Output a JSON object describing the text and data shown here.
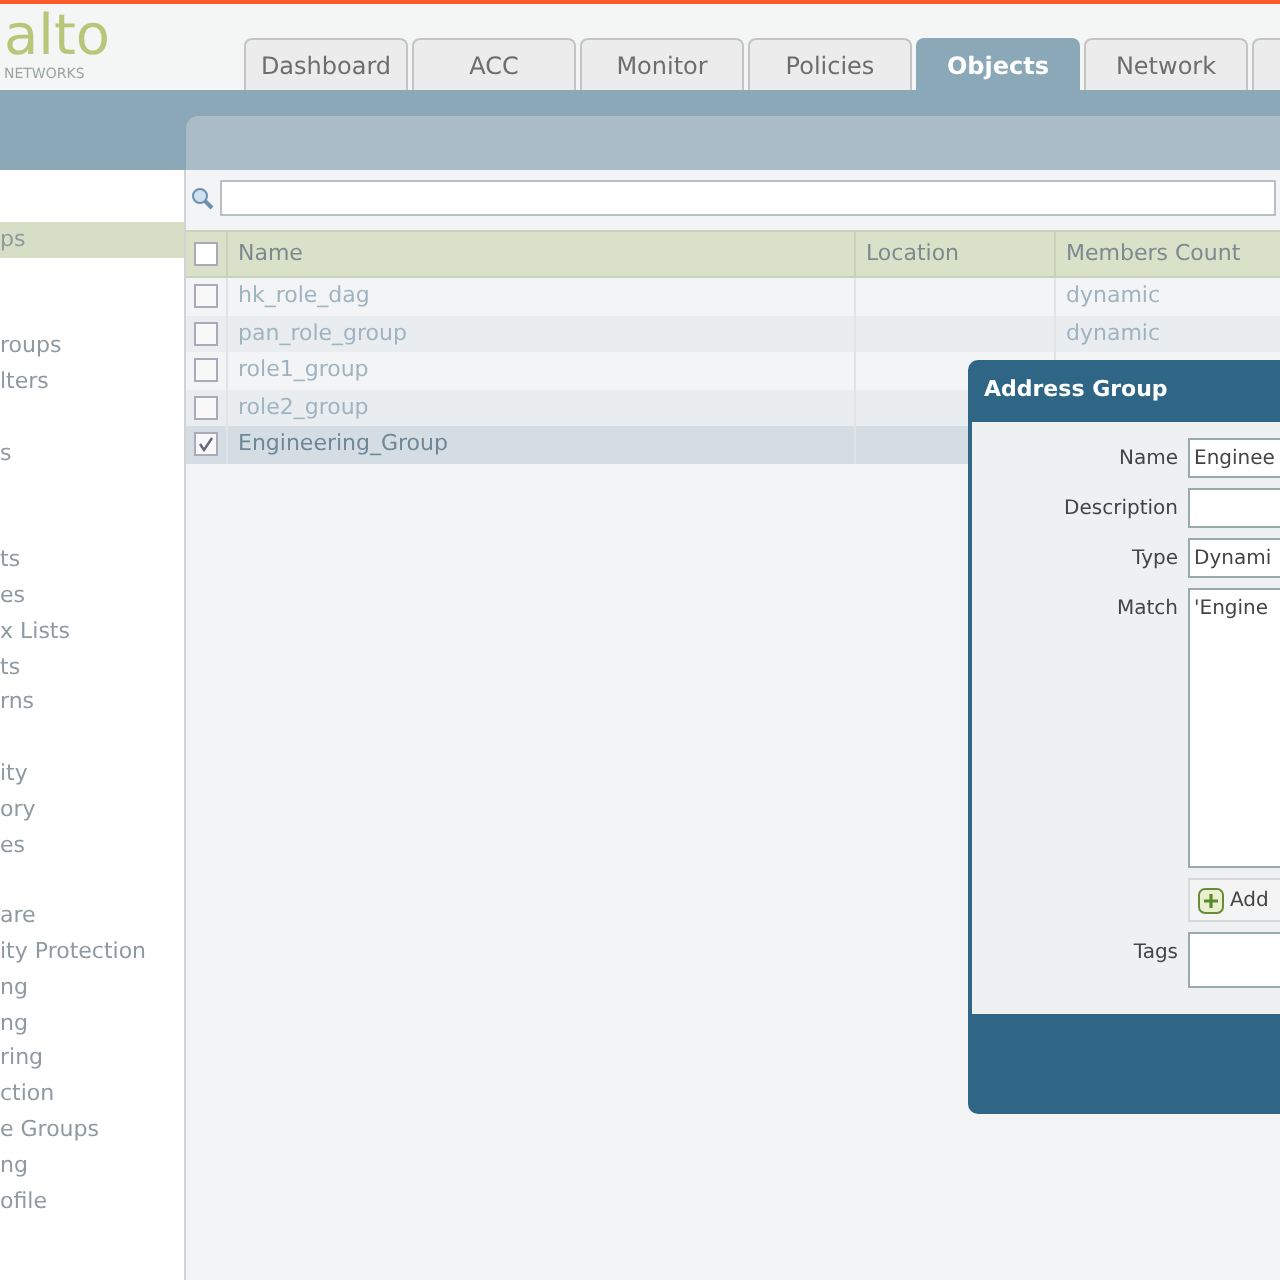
{
  "logo": {
    "wordmark": "alto",
    "tagline": "NETWORKS"
  },
  "tabs": [
    {
      "label": "Dashboard",
      "selected": false
    },
    {
      "label": "ACC",
      "selected": false
    },
    {
      "label": "Monitor",
      "selected": false
    },
    {
      "label": "Policies",
      "selected": false
    },
    {
      "label": "Objects",
      "selected": true
    },
    {
      "label": "Network",
      "selected": false
    }
  ],
  "sidebar": {
    "groups": [
      {
        "items": [
          {
            "label": "ps",
            "selected": true
          }
        ]
      },
      {
        "items": [
          {
            "label": "roups",
            "selected": false
          },
          {
            "label": "lters",
            "selected": false
          }
        ]
      },
      {
        "items": [
          {
            "label": "s",
            "selected": false
          }
        ]
      },
      {
        "items": [
          {
            "label": "ts",
            "selected": false
          },
          {
            "label": "es",
            "selected": false
          },
          {
            "label": "x Lists",
            "selected": false
          },
          {
            "label": "ts",
            "selected": false
          },
          {
            "label": "rns",
            "selected": false
          }
        ]
      },
      {
        "items": [
          {
            "label": "ity",
            "selected": false
          },
          {
            "label": "ory",
            "selected": false
          },
          {
            "label": "es",
            "selected": false
          }
        ]
      },
      {
        "items": [
          {
            "label": "are",
            "selected": false
          },
          {
            "label": "ity Protection",
            "selected": false
          },
          {
            "label": "ng",
            "selected": false
          },
          {
            "label": "ng",
            "selected": false
          },
          {
            "label": "ring",
            "selected": false
          },
          {
            "label": "ction",
            "selected": false
          },
          {
            "label": "e Groups",
            "selected": false
          },
          {
            "label": "ng",
            "selected": false
          },
          {
            "label": "ofile",
            "selected": false
          }
        ]
      }
    ]
  },
  "table": {
    "all_checked": false,
    "columns": [
      "Name",
      "Location",
      "Members Count"
    ],
    "rows": [
      {
        "name": "hk_role_dag",
        "members_count": "dynamic",
        "checked": false,
        "selected": false
      },
      {
        "name": "pan_role_group",
        "members_count": "dynamic",
        "checked": false,
        "selected": false
      },
      {
        "name": "role1_group",
        "checked": false,
        "selected": false
      },
      {
        "name": "role2_group",
        "checked": false,
        "selected": false
      },
      {
        "name": "Engineering_Group",
        "checked": true,
        "selected": true
      }
    ]
  },
  "dialog": {
    "title": "Address Group",
    "fields": [
      {
        "kind": "text",
        "label": "Name",
        "value": "Enginee"
      },
      {
        "kind": "text",
        "label": "Description"
      },
      {
        "kind": "text",
        "label": "Type",
        "value": "Dynami"
      },
      {
        "kind": "textarea",
        "label": "Match",
        "value": "'Engine"
      },
      {
        "kind": "button",
        "label": "Add"
      },
      {
        "kind": "tags",
        "label": "Tags"
      }
    ]
  }
}
